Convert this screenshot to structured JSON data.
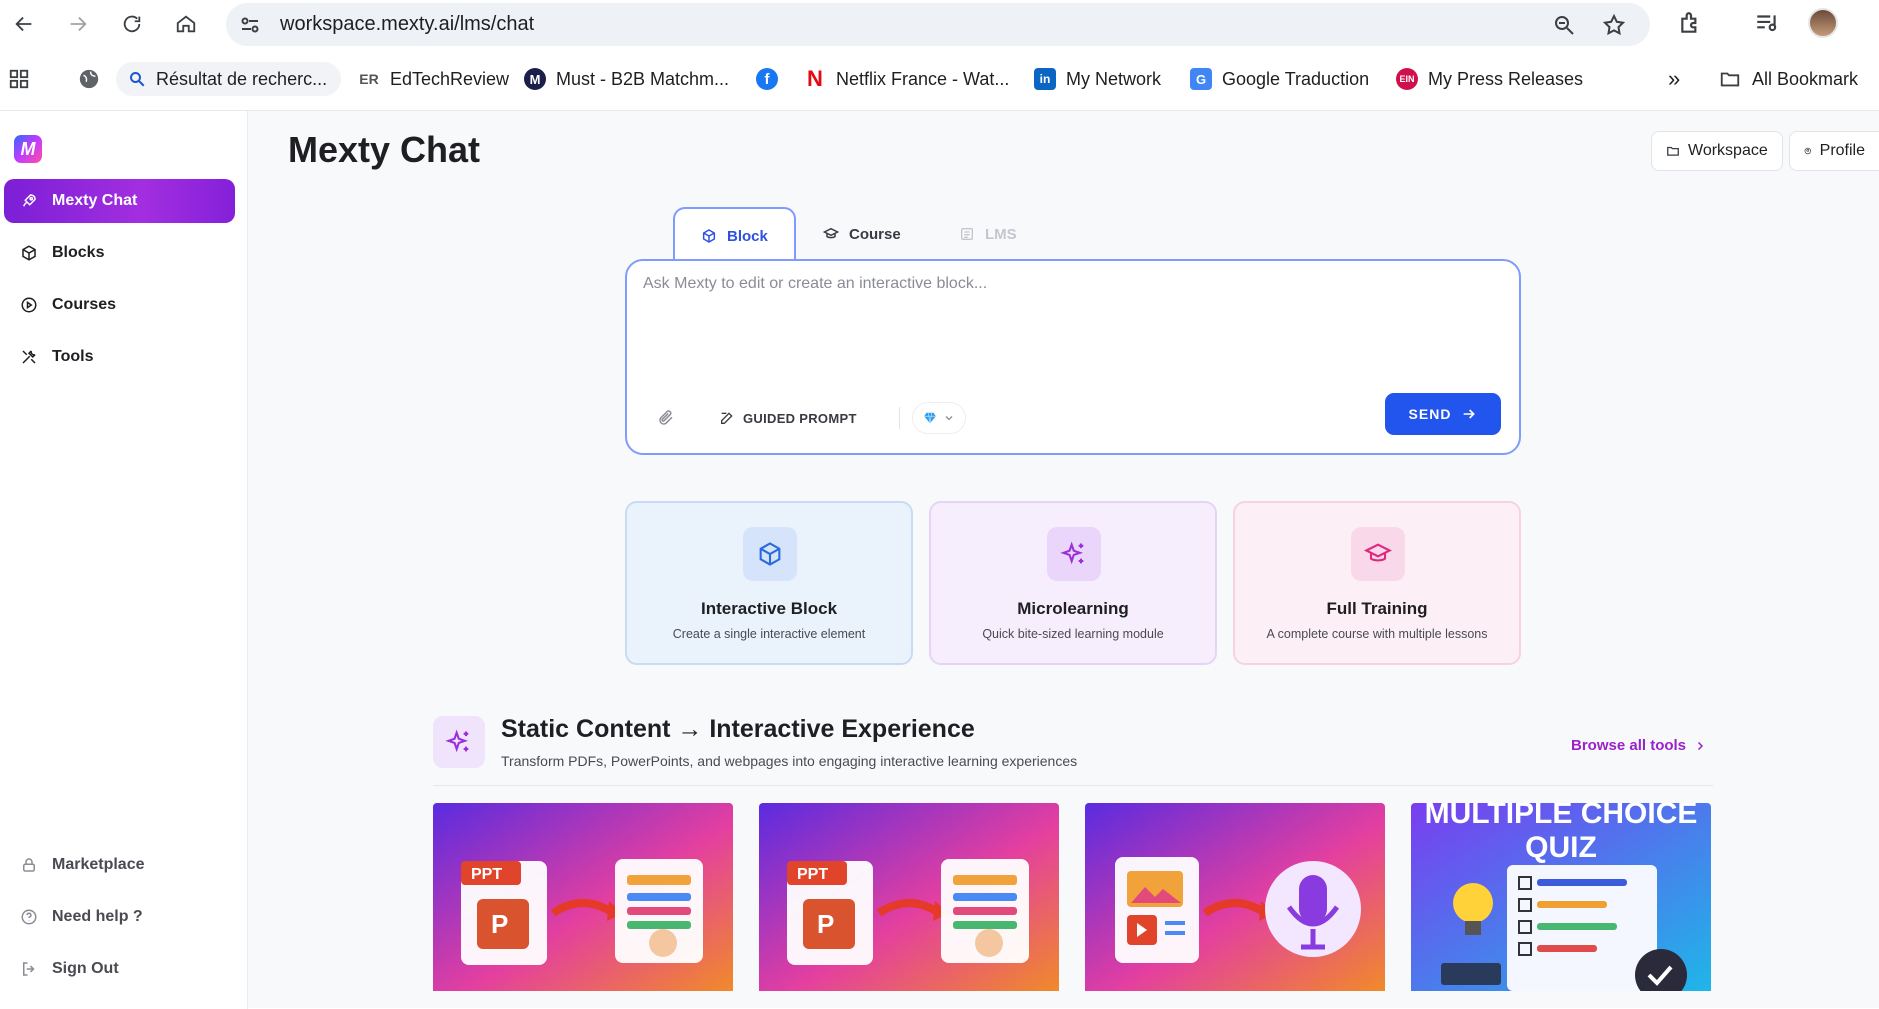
{
  "browser": {
    "url": "workspace.mexty.ai/lms/chat",
    "bookmarks": [
      {
        "label": "Résultat de recherc..."
      },
      {
        "label": "EdTechReview"
      },
      {
        "label": "Must - B2B Matchm..."
      },
      {
        "label": ""
      },
      {
        "label": "Netflix France - Wat..."
      },
      {
        "label": "My Network"
      },
      {
        "label": "Google Traduction"
      },
      {
        "label": "My Press Releases"
      }
    ],
    "all_bookmarks": "All Bookmark"
  },
  "sidebar": {
    "logo": "M",
    "items": [
      {
        "label": "Mexty Chat",
        "icon": "rocket-icon"
      },
      {
        "label": "Blocks",
        "icon": "cube-icon"
      },
      {
        "label": "Courses",
        "icon": "play-circle-icon"
      },
      {
        "label": "Tools",
        "icon": "tools-icon"
      }
    ],
    "bottom": [
      {
        "label": "Marketplace",
        "icon": "lock-icon"
      },
      {
        "label": "Need help ?",
        "icon": "help-icon"
      },
      {
        "label": "Sign Out",
        "icon": "sign-out-icon"
      }
    ]
  },
  "header": {
    "title": "Mexty Chat",
    "workspace_btn": "Workspace",
    "profile_btn": "Profile"
  },
  "composer": {
    "tabs": [
      {
        "label": "Block",
        "state": "active"
      },
      {
        "label": "Course",
        "state": "normal"
      },
      {
        "label": "LMS",
        "state": "disabled"
      }
    ],
    "placeholder": "Ask Mexty to edit or create an interactive block...",
    "value": "",
    "guided_prompt": "GUIDED PROMPT",
    "send": "SEND"
  },
  "cards": [
    {
      "title": "Interactive Block",
      "desc": "Create a single interactive element"
    },
    {
      "title": "Microlearning",
      "desc": "Quick bite-sized learning module"
    },
    {
      "title": "Full Training",
      "desc": "A complete course with multiple lessons"
    }
  ],
  "section": {
    "title": "Static Content → Interactive Experience",
    "subtitle": "Transform PDFs, PowerPoints, and webpages into engaging interactive learning experiences",
    "browse": "Browse all tools"
  },
  "thumbnails": [
    {
      "label": ""
    },
    {
      "label": ""
    },
    {
      "label": ""
    },
    {
      "label": "MULTIPLE CHOICE QUIZ"
    }
  ],
  "colors": {
    "accent": "#2255ee",
    "brand_purple": "#9b21c8",
    "active_nav": "#8a22dc"
  }
}
